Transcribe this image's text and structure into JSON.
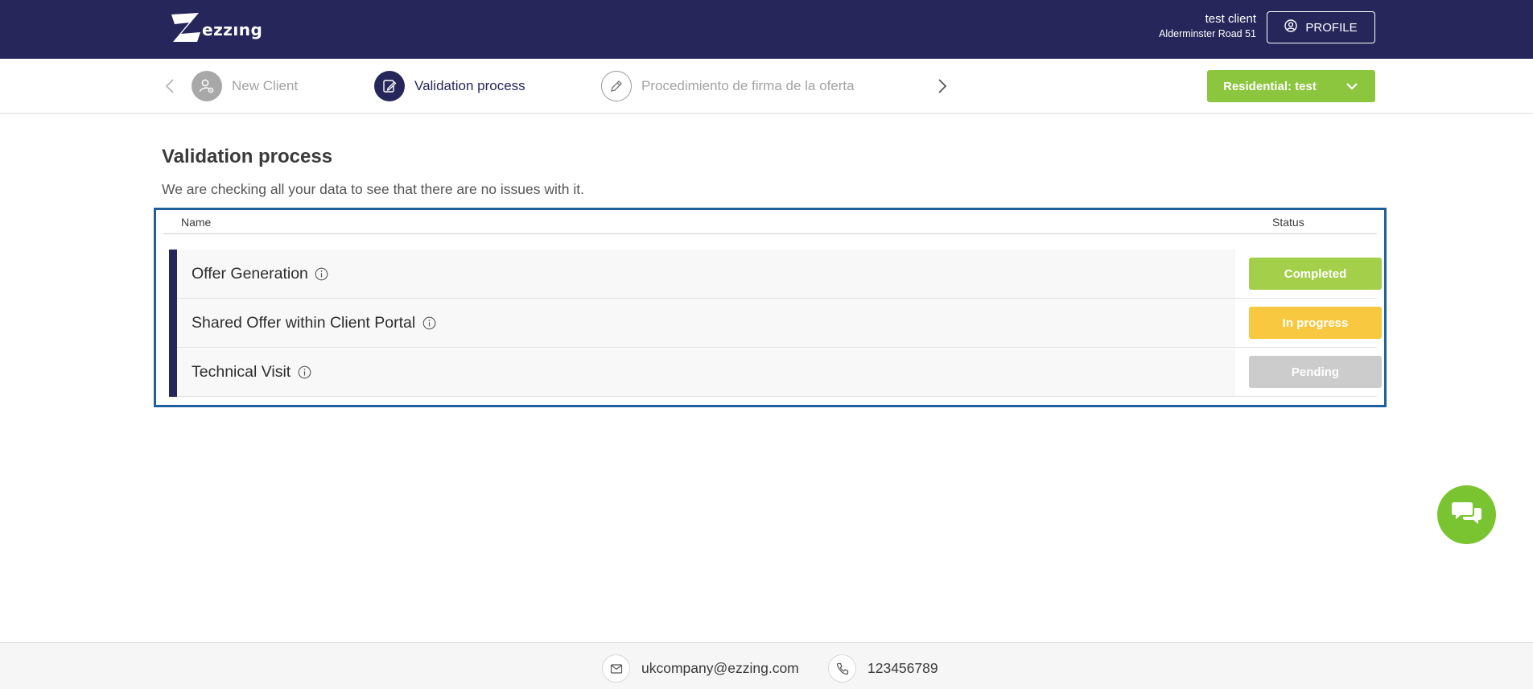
{
  "header": {
    "logo_text": "ezzıng",
    "user_name": "test client",
    "user_address": "Alderminster Road 51",
    "profile_label": "PROFILE"
  },
  "stepper": {
    "steps": [
      {
        "label": "New Client",
        "state": "inactive",
        "icon": "user-gear-icon"
      },
      {
        "label": "Validation process",
        "state": "active",
        "icon": "edit-document-icon"
      },
      {
        "label": "Procedimiento de firma de la oferta",
        "state": "inactive",
        "icon": "pen-icon"
      }
    ],
    "selector_label": "Residential: test"
  },
  "main": {
    "title": "Validation process",
    "subtitle": "We are checking all your data to see that there are no issues with it.",
    "table": {
      "headers": {
        "name": "Name",
        "status": "Status"
      },
      "rows": [
        {
          "name": "Offer Generation",
          "status": "Completed"
        },
        {
          "name": "Shared Offer within Client Portal",
          "status": "In progress"
        },
        {
          "name": "Technical Visit",
          "status": "Pending"
        }
      ]
    }
  },
  "footer": {
    "email": "ukcompany@ezzing.com",
    "phone": "123456789"
  },
  "colors": {
    "brand_navy": "#26265b",
    "accent_green": "#8cc63f",
    "status_completed": "#a4cf4a",
    "status_in_progress": "#f8c940",
    "status_pending": "#cccccc",
    "highlight_border": "#1f5f9b",
    "chat_green": "#7ac431"
  }
}
